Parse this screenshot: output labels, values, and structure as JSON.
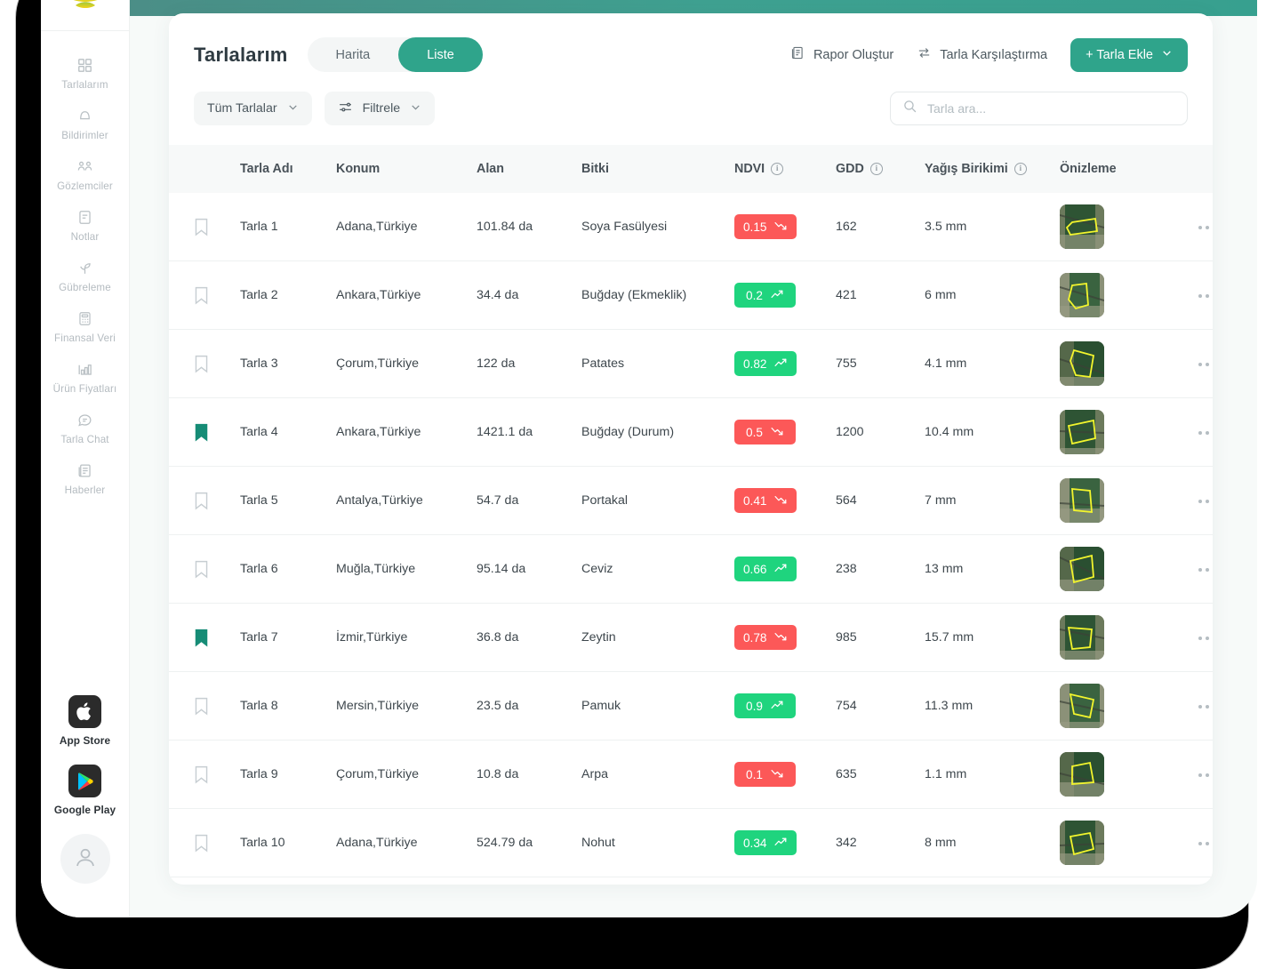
{
  "sidebar": {
    "logo_name": "tarla-logo",
    "items": [
      {
        "label": "Tarlalarım",
        "icon": "grid-icon"
      },
      {
        "label": "Bildirimler",
        "icon": "bell-icon"
      },
      {
        "label": "Gözlemciler",
        "icon": "users-icon"
      },
      {
        "label": "Notlar",
        "icon": "note-icon"
      },
      {
        "label": "Gübreleme",
        "icon": "sprout-icon"
      },
      {
        "label": "Finansal Veri",
        "icon": "calculator-icon"
      },
      {
        "label": "Ürün Fiyatları",
        "icon": "bar-chart-icon"
      },
      {
        "label": "Tarla Chat",
        "icon": "chat-icon"
      },
      {
        "label": "Haberler",
        "icon": "news-icon"
      }
    ],
    "stores": [
      {
        "label": "App Store",
        "icon": "apple-icon"
      },
      {
        "label": "Google Play",
        "icon": "google-play-icon"
      }
    ],
    "avatar": "user-avatar-icon"
  },
  "header": {
    "title": "Tarlalarım",
    "tabs": [
      {
        "label": "Harita",
        "active": false
      },
      {
        "label": "Liste",
        "active": true
      }
    ],
    "actions": [
      {
        "label": "Rapor Oluştur",
        "icon": "report-icon"
      },
      {
        "label": "Tarla Karşılaştırma",
        "icon": "compare-icon"
      }
    ],
    "add_button": "+ Tarla Ekle"
  },
  "filters": {
    "all_fields": "Tüm Tarlalar",
    "filter": "Filtrele",
    "search_placeholder": "Tarla ara...",
    "search_value": ""
  },
  "table": {
    "columns": [
      {
        "key": "name",
        "label": "Tarla Adı",
        "info": false
      },
      {
        "key": "loc",
        "label": "Konum",
        "info": false
      },
      {
        "key": "area",
        "label": "Alan",
        "info": false
      },
      {
        "key": "crop",
        "label": "Bitki",
        "info": false
      },
      {
        "key": "ndvi",
        "label": "NDVI",
        "info": true
      },
      {
        "key": "gdd",
        "label": "GDD",
        "info": true
      },
      {
        "key": "rain",
        "label": "Yağış Birikimi",
        "info": true
      },
      {
        "key": "prev",
        "label": "Önizleme",
        "info": false
      }
    ],
    "rows": [
      {
        "flagged": false,
        "name": "Tarla 1",
        "loc": "Adana,Türkiye",
        "area": "101.84 da",
        "crop": "Soya Fasülyesi",
        "ndvi": "0.15",
        "trend": "down",
        "gdd": "162",
        "rain": "3.5 mm"
      },
      {
        "flagged": false,
        "name": "Tarla 2",
        "loc": "Ankara,Türkiye",
        "area": "34.4 da",
        "crop": "Buğday (Ekmeklik)",
        "ndvi": "0.2",
        "trend": "up",
        "gdd": "421",
        "rain": "6 mm"
      },
      {
        "flagged": false,
        "name": "Tarla 3",
        "loc": "Çorum,Türkiye",
        "area": "122 da",
        "crop": "Patates",
        "ndvi": "0.82",
        "trend": "up",
        "gdd": "755",
        "rain": "4.1 mm"
      },
      {
        "flagged": true,
        "name": "Tarla 4",
        "loc": "Ankara,Türkiye",
        "area": "1421.1 da",
        "crop": "Buğday (Durum)",
        "ndvi": "0.5",
        "trend": "down",
        "gdd": "1200",
        "rain": "10.4 mm"
      },
      {
        "flagged": false,
        "name": "Tarla 5",
        "loc": "Antalya,Türkiye",
        "area": "54.7 da",
        "crop": "Portakal",
        "ndvi": "0.41",
        "trend": "down",
        "gdd": "564",
        "rain": "7 mm"
      },
      {
        "flagged": false,
        "name": "Tarla 6",
        "loc": "Muğla,Türkiye",
        "area": "95.14 da",
        "crop": "Ceviz",
        "ndvi": "0.66",
        "trend": "up",
        "gdd": "238",
        "rain": "13 mm"
      },
      {
        "flagged": true,
        "name": "Tarla 7",
        "loc": "İzmir,Türkiye",
        "area": "36.8 da",
        "crop": "Zeytin",
        "ndvi": "0.78",
        "trend": "down",
        "gdd": "985",
        "rain": "15.7 mm"
      },
      {
        "flagged": false,
        "name": "Tarla 8",
        "loc": "Mersin,Türkiye",
        "area": "23.5 da",
        "crop": "Pamuk",
        "ndvi": "0.9",
        "trend": "up",
        "gdd": "754",
        "rain": "11.3 mm"
      },
      {
        "flagged": false,
        "name": "Tarla 9",
        "loc": "Çorum,Türkiye",
        "area": "10.8 da",
        "crop": "Arpa",
        "ndvi": "0.1",
        "trend": "down",
        "gdd": "635",
        "rain": "1.1 mm"
      },
      {
        "flagged": false,
        "name": "Tarla 10",
        "loc": "Adana,Türkiye",
        "area": "524.79 da",
        "crop": "Nohut",
        "ndvi": "0.34",
        "trend": "up",
        "gdd": "342",
        "rain": "8 mm"
      }
    ]
  },
  "colors": {
    "accent": "#2fa48b",
    "teal_bar": "#3fa191",
    "badge_up": "#1fd47e",
    "badge_down": "#fc5858",
    "bookmark_active": "#168c76"
  }
}
